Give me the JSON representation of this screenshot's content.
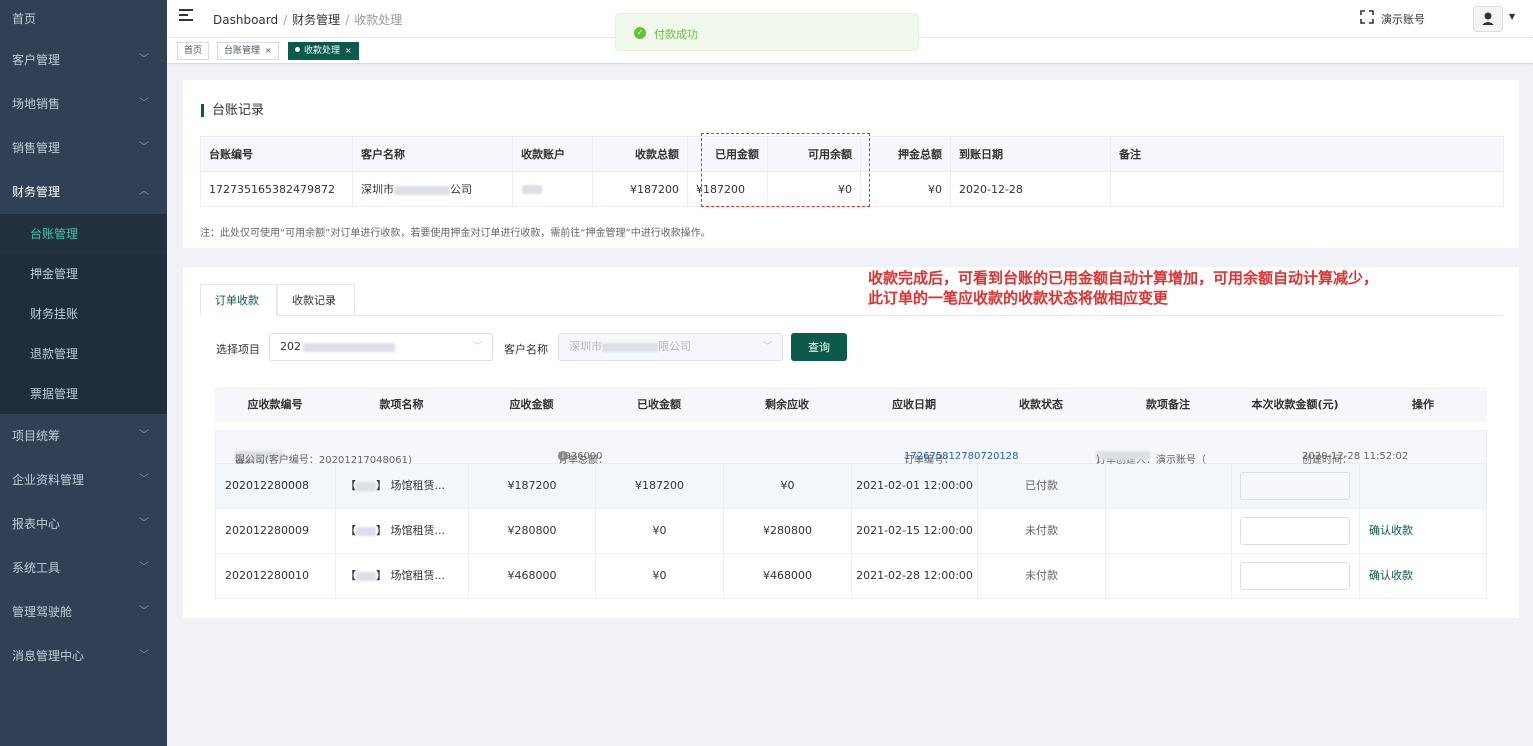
{
  "sidebar": {
    "items": [
      {
        "label": "首页",
        "chevron": false
      },
      {
        "label": "客户管理",
        "chevron": true
      },
      {
        "label": "场地销售",
        "chevron": true
      },
      {
        "label": "销售管理",
        "chevron": true
      },
      {
        "label": "财务管理",
        "chevron": true,
        "expanded": true
      },
      {
        "label": "项目统筹",
        "chevron": true
      },
      {
        "label": "企业资料管理",
        "chevron": true
      },
      {
        "label": "报表中心",
        "chevron": true
      },
      {
        "label": "系统工具",
        "chevron": true
      },
      {
        "label": "管理驾驶舱",
        "chevron": true
      },
      {
        "label": "消息管理中心",
        "chevron": true
      }
    ],
    "finance_sub": [
      "台账管理",
      "押金管理",
      "财务挂账",
      "退款管理",
      "票据管理"
    ],
    "active_sub": "台账管理"
  },
  "header": {
    "breadcrumb": [
      "Dashboard",
      "财务管理",
      "收款处理"
    ],
    "account": "演示账号",
    "icons": {
      "menu": "hamburger-icon",
      "fullscreen": "fullscreen-icon",
      "avatar": "user-icon"
    }
  },
  "tags": [
    {
      "label": "首页",
      "active": false,
      "closable": false
    },
    {
      "label": "台账管理",
      "active": false,
      "closable": true
    },
    {
      "label": "收款处理",
      "active": true,
      "closable": true
    }
  ],
  "toast": {
    "message": "付款成功",
    "type": "success"
  },
  "ledger": {
    "title": "台账记录",
    "columns": [
      "台账编号",
      "客户名称",
      "收款账户",
      "收款总额",
      "已用金额",
      "可用余额",
      "押金总额",
      "到账日期",
      "备注"
    ],
    "row": {
      "id": "172735165382479872",
      "customer_prefix": "深圳市",
      "customer_suffix": "公司",
      "total": "¥187200",
      "used": "¥187200",
      "available": "¥0",
      "deposit": "¥0",
      "date": "2020-12-28",
      "remark": ""
    },
    "note": "注：此处仅可使用“可用余额”对订单进行收款，若要使用押金对订单进行收款，需前往“押金管理”中进行收款操作。"
  },
  "annotation": {
    "line1": "收款完成后，可看到台账的已用金额自动计算增加，可用余额自动计算减少，",
    "line2": "此订单的一笔应收款的收款状态将做相应变更",
    "color": "#e0302f"
  },
  "tabs": [
    "订单收款",
    "收款记录"
  ],
  "filters": {
    "project_label": "选择项目",
    "project_value_prefix": "202",
    "customer_label": "客户名称",
    "customer_prefix": "深圳市",
    "customer_suffix": "限公司",
    "query_label": "查询"
  },
  "orders": {
    "columns": [
      "应收款编号",
      "款项名称",
      "应收金额",
      "已收金额",
      "剩余应收",
      "应收日期",
      "收款状态",
      "款项备注",
      "本次收款金额(元)",
      "操作"
    ],
    "meta": {
      "customer_label": "客户：",
      "customer_prefix": "深圳市",
      "customer_suffix": "限公司(客户编号：20201217048061)",
      "total_label": "订单总额：",
      "total_value": "¥936000",
      "order_no_label": "订单编号：",
      "order_no": "172675812780720128",
      "creator_label": "订单创建人：演示账号（",
      "creator_suffix": "）",
      "created_label": "创建时间：",
      "created_value": "2020-12-28 11:52:02"
    },
    "rows": [
      {
        "id": "202012280008",
        "name_bracket_l": "【",
        "name_bracket_r": "】",
        "name": "场馆租赁...",
        "due": "¥187200",
        "received": "¥187200",
        "remaining": "¥0",
        "date": "2021-02-01 12:00:00",
        "status": "已付款",
        "remark": "",
        "action": ""
      },
      {
        "id": "202012280009",
        "name_bracket_l": "【",
        "name_bracket_r": "】",
        "name": "场馆租赁...",
        "due": "¥280800",
        "received": "¥0",
        "remaining": "¥280800",
        "date": "2021-02-15 12:00:00",
        "status": "未付款",
        "remark": "",
        "action": "确认收款"
      },
      {
        "id": "202012280010",
        "name_bracket_l": "【",
        "name_bracket_r": "】",
        "name": "场馆租赁...",
        "due": "¥468000",
        "received": "¥0",
        "remaining": "¥468000",
        "date": "2021-02-28 12:00:00",
        "status": "未付款",
        "remark": "",
        "action": "确认收款"
      }
    ]
  },
  "colors": {
    "primary": "#0b5a4a",
    "sidebar": "#304156",
    "success": "#67c23a",
    "link": "#2060c0"
  }
}
